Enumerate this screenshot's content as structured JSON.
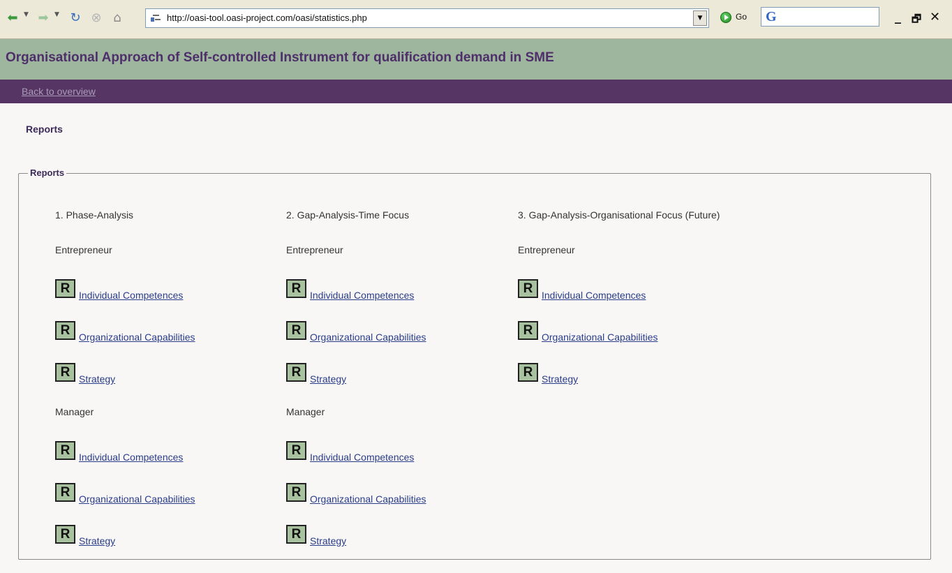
{
  "browser": {
    "url": "http://oasi-tool.oasi-project.com/oasi/statistics.php",
    "go_label": "Go",
    "search_logo": "G"
  },
  "page": {
    "title": "Organisational Approach of Self-controlled Instrument for qualification demand in SME",
    "back_link": "Back to overview",
    "section_heading": "Reports",
    "fieldset_legend": "Reports"
  },
  "columns": [
    {
      "title": "1. Phase-Analysis",
      "groups": [
        {
          "label": "Entrepreneur",
          "items": [
            "Individual Competences",
            "Organizational Capabilities",
            "Strategy"
          ]
        },
        {
          "label": "Manager",
          "items": [
            "Individual Competences",
            "Organizational Capabilities",
            "Strategy"
          ]
        }
      ]
    },
    {
      "title": "2. Gap-Analysis-Time Focus",
      "groups": [
        {
          "label": "Entrepreneur",
          "items": [
            "Individual Competences",
            "Organizational Capabilities",
            "Strategy"
          ]
        },
        {
          "label": "Manager",
          "items": [
            "Individual Competences",
            "Organizational Capabilities",
            "Strategy"
          ]
        }
      ]
    },
    {
      "title": "3. Gap-Analysis-Organisational Focus (Future)",
      "groups": [
        {
          "label": "Entrepreneur",
          "items": [
            "Individual Competences",
            "Organizational Capabilities",
            "Strategy"
          ]
        }
      ]
    }
  ],
  "report_icon_letter": "R",
  "colors": {
    "header_bg": "#9eb69d",
    "nav_bg": "#563565",
    "title_text": "#4e2f6b",
    "icon_bg": "#a8c19e",
    "link": "#2a3d8a"
  }
}
